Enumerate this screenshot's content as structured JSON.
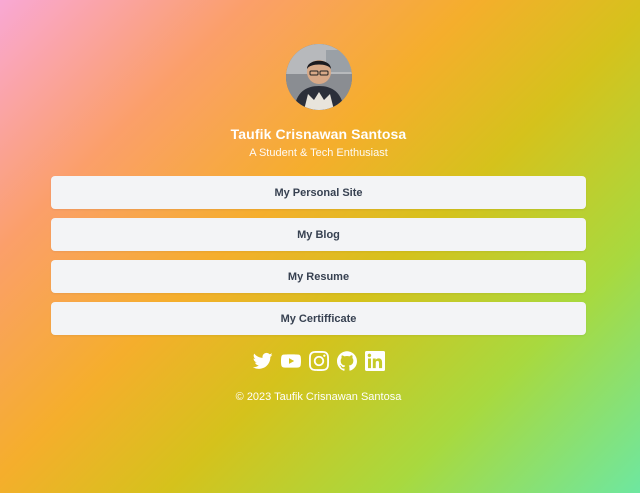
{
  "profile": {
    "name": "Taufik Crisnawan Santosa",
    "tagline": "A Student & Tech Enthusiast"
  },
  "links": [
    {
      "label": "My Personal Site"
    },
    {
      "label": "My Blog"
    },
    {
      "label": "My Resume"
    },
    {
      "label": "My Certifficate"
    }
  ],
  "socials": [
    "twitter-icon",
    "youtube-icon",
    "instagram-icon",
    "github-icon",
    "linkedin-icon"
  ],
  "footer": {
    "copyright": "© 2023 Taufik Crisnawan Santosa"
  },
  "colors": {
    "button_bg": "#f3f4f6",
    "button_text": "#374151",
    "text": "#ffffff"
  }
}
